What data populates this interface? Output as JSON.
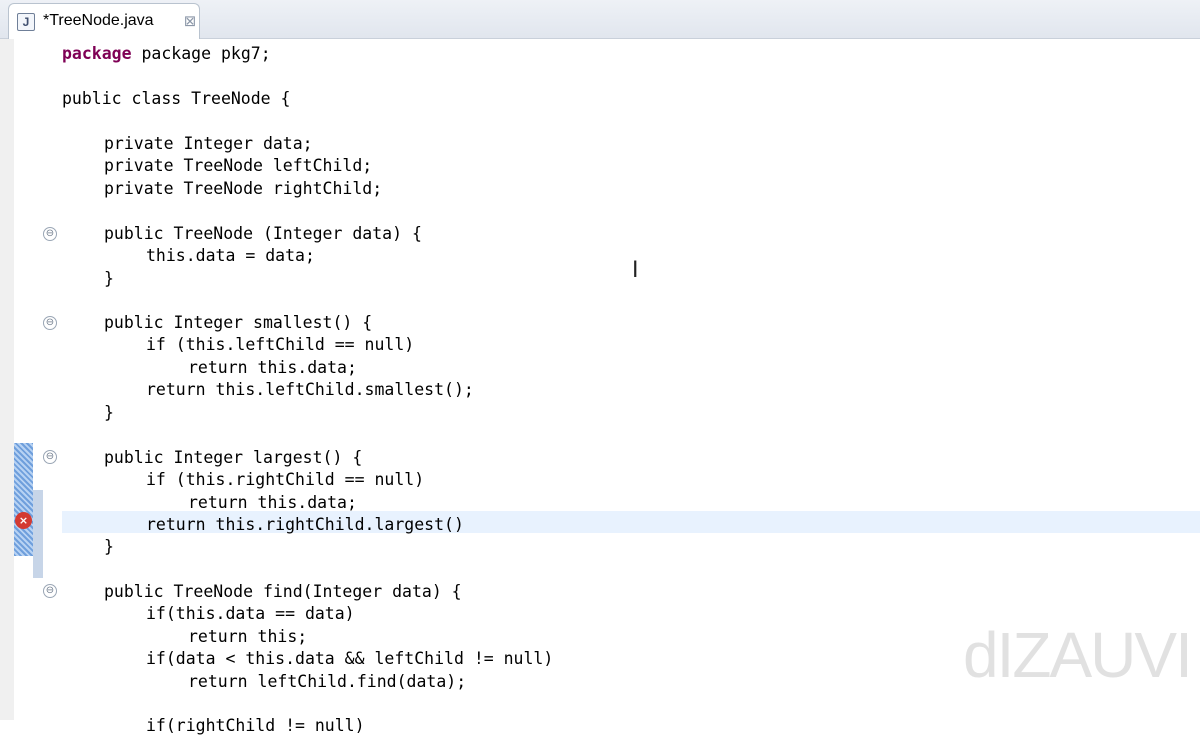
{
  "tab": {
    "title": "*TreeNode.java",
    "icon": "J",
    "close": "⊠"
  },
  "watermark": "dIZAUVI",
  "lines": [
    "package pkg7;",
    "public class TreeNode {",
    "private Integer data;",
    "private TreeNode leftChild;",
    "private TreeNode rightChild;",
    "public TreeNode (Integer data) {",
    "this.data = data;",
    "}",
    "public Integer smallest() {",
    "if (this.leftChild == null)",
    "return this.data;",
    "return this.leftChild.smallest();",
    "}",
    "public Integer largest() {",
    "if (this.rightChild == null)",
    "return this.data;",
    "return this.rightChild.largest()",
    "}",
    "public TreeNode find(Integer data) {",
    "if(this.data == data)",
    "return this;",
    "if(data < this.data && leftChild != null)",
    "return leftChild.find(data);",
    "if(rightChild != null)"
  ]
}
